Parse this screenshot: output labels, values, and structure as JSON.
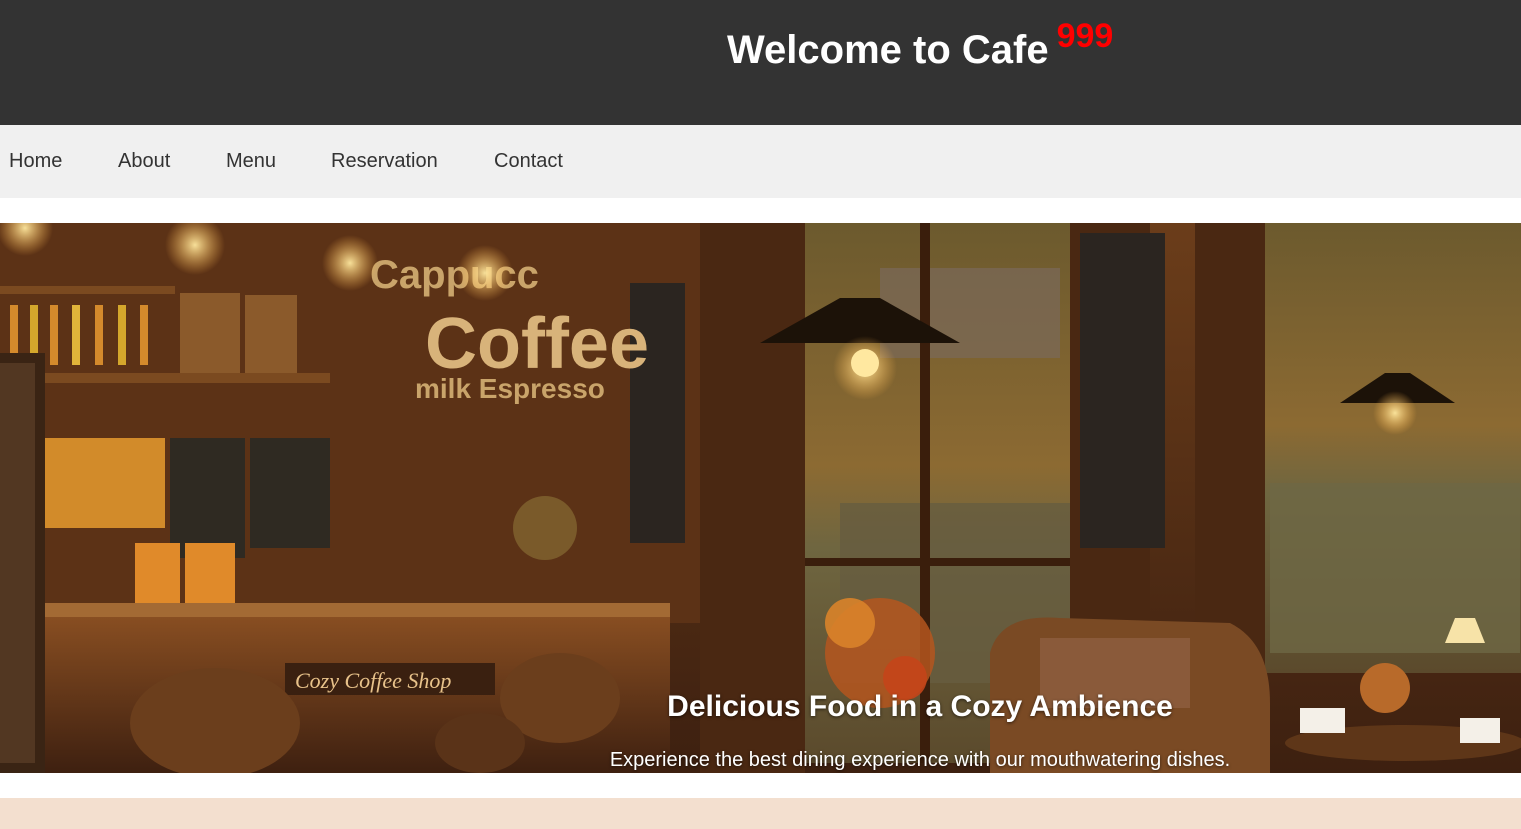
{
  "header": {
    "title": "Welcome to Cafe",
    "number": "999",
    "background": "#333333",
    "number_color": "#ff0000"
  },
  "nav": {
    "items": [
      "Home",
      "About",
      "Menu",
      "Reservation",
      "Contact"
    ],
    "background": "#f0f0f0"
  },
  "hero": {
    "heading": "Delicious Food in a Cozy Ambience",
    "subtext": "Experience the best dining experience with our mouthwatering dishes."
  },
  "next_section": {
    "background": "#f3dfcf"
  }
}
